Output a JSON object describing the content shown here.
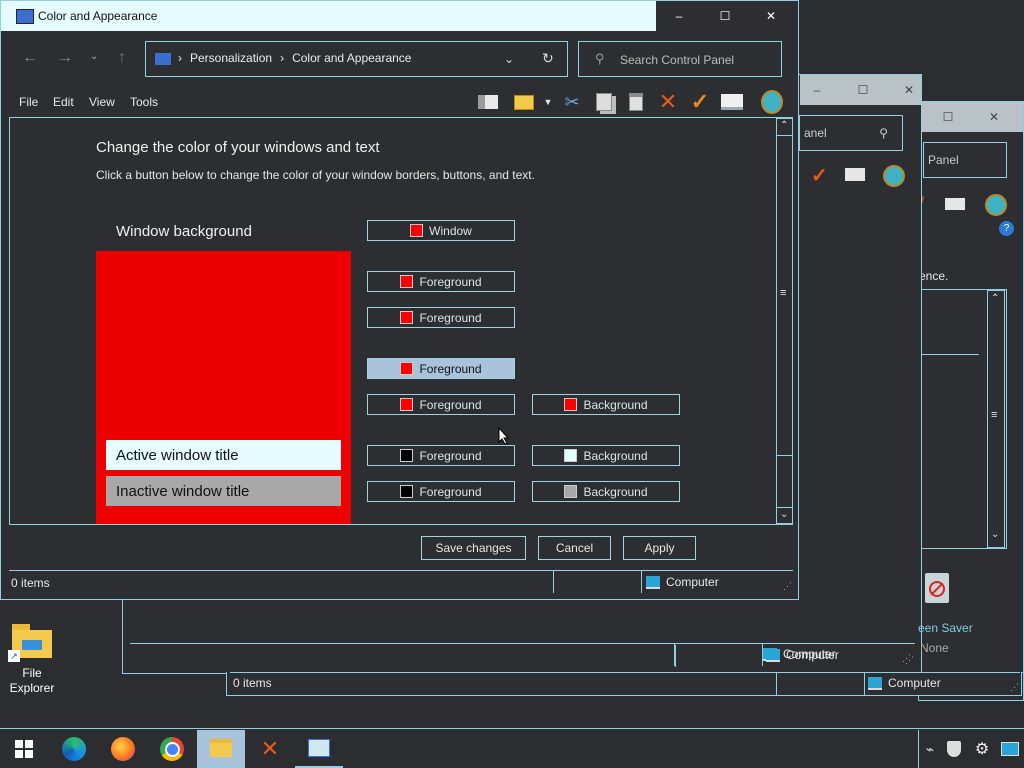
{
  "back_windows": {
    "win3": {
      "search_placeholder": "Panel",
      "partial_text": "ence.",
      "status_items": "0 items",
      "status_computer": "Computer"
    },
    "win2": {
      "search_placeholder": "anel",
      "status_computer": "Computer",
      "screen_saver_label": "een Saver",
      "screen_saver_value": "None"
    }
  },
  "window": {
    "title": "Color and Appearance",
    "breadcrumb": [
      "Personalization",
      "Color and Appearance"
    ],
    "search_placeholder": "Search Control Panel",
    "menu": [
      "File",
      "Edit",
      "View",
      "Tools"
    ],
    "heading": "Change the color of your windows and text",
    "subheading": "Click a button below to change the color of your window borders, buttons, and text.",
    "preview": {
      "bg_label": "Window background",
      "active_title": "Active window title",
      "inactive_title": "Inactive window title"
    },
    "color_rows": [
      {
        "fg_label": "Window",
        "fg_color": "#ff0000"
      },
      {
        "fg_label": "Foreground",
        "fg_color": "#ff0000"
      },
      {
        "fg_label": "Foreground",
        "fg_color": "#ff0000"
      },
      {
        "fg_label": "Foreground",
        "fg_color": "#ff0000",
        "selected": true
      },
      {
        "fg_label": "Foreground",
        "fg_color": "#ff0000",
        "bg_label": "Background",
        "bg_color": "#ff0000"
      },
      {
        "fg_label": "Foreground",
        "fg_color": "#000000",
        "bg_label": "Background",
        "bg_color": "#e4ffff"
      },
      {
        "fg_label": "Foreground",
        "fg_color": "#000000",
        "bg_label": "Background",
        "bg_color": "#a8a8a8"
      }
    ],
    "buttons": {
      "save": "Save changes",
      "cancel": "Cancel",
      "apply": "Apply"
    },
    "status": {
      "items": "0 items",
      "computer": "Computer"
    }
  },
  "desktop": {
    "file_explorer_label": "File\nExplorer"
  },
  "colors": {
    "accent": "#8fd0e0",
    "preview_red": "#ee0000",
    "selected_btn": "#a9c3dd"
  }
}
